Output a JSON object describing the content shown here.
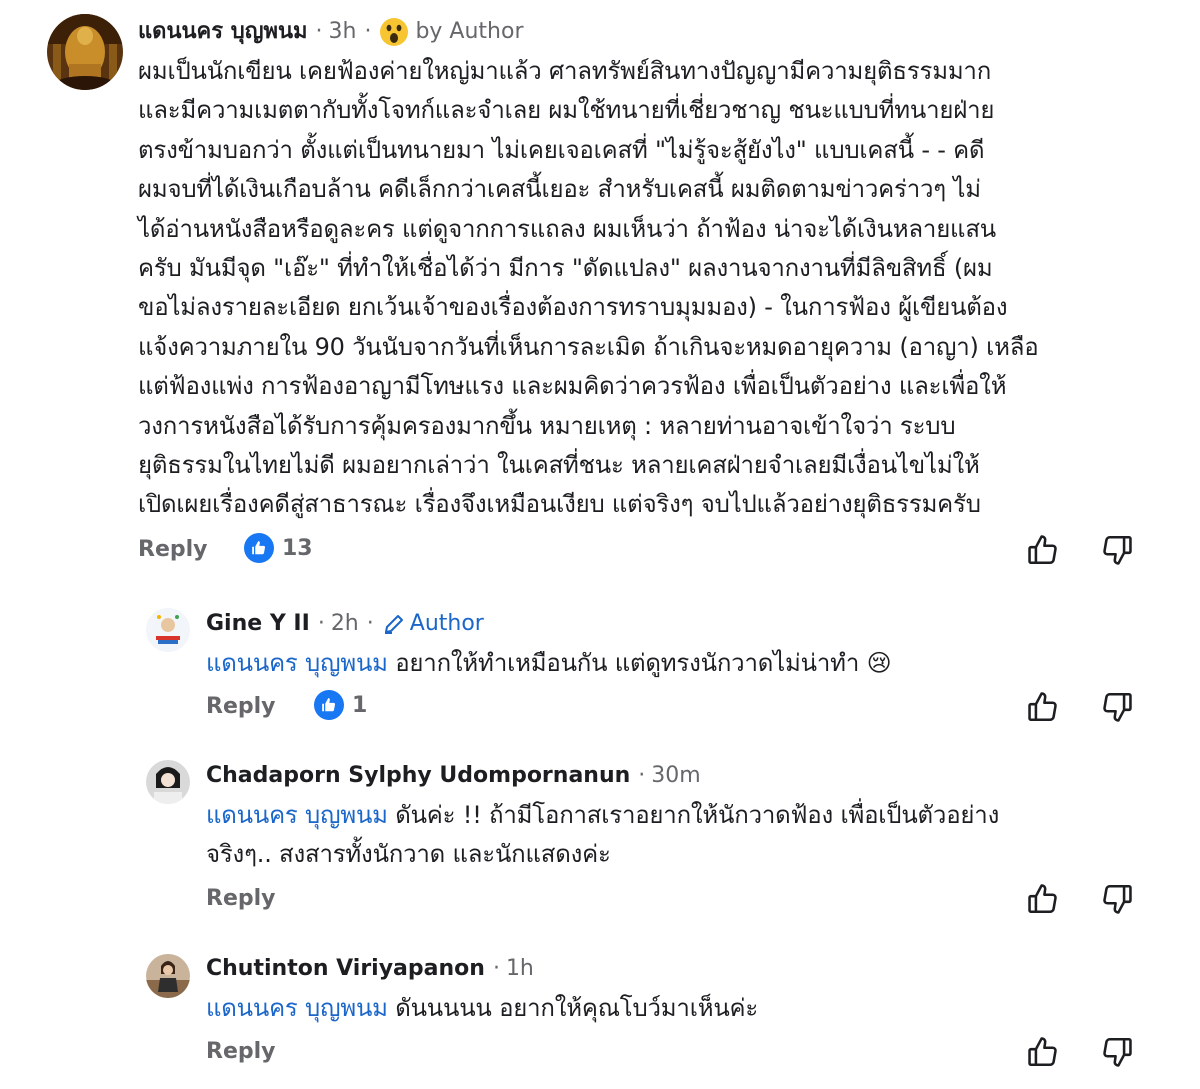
{
  "comments": [
    {
      "name": "แดนนคร บุญพนม",
      "time": "3h",
      "author_tag": "by Author",
      "mention": "",
      "lines": [
        "ผมเป็นนักเขียน  เคยฟ้องค่ายใหญ่มาแล้ว  ศาลทรัพย์สินทางปัญญามีความยุติธรรมมาก",
        "และมีความเมตตากับทั้งโจทก์และจำเลย  ผมใช้ทนายที่เชี่ยวชาญ  ชนะแบบที่ทนายฝ่าย",
        "ตรงข้ามบอกว่า ตั้งแต่เป็นทนายมา ไม่เคยเจอเคสที่ \"ไม่รู้จะสู้ยังไง\" แบบเคสนี้  - - คดี",
        "ผมจบที่ได้เงินเกือบล้าน  คดีเล็กกว่าเคสนี้เยอะ  สำหรับเคสนี้  ผมติดตามข่าวคร่าวๆ  ไม่",
        "ได้อ่านหนังสือหรือดูละคร  แต่ดูจากการแถลง  ผมเห็นว่า ถ้าฟ้อง น่าจะได้เงินหลายแสน",
        "ครับ  มันมีจุด \"เอ๊ะ\" ที่ทำให้เชื่อได้ว่า มีการ \"ดัดแปลง\" ผลงานจากงานที่มีลิขสิทธิ์  (ผม",
        "ขอไม่ลงรายละเอียด  ยกเว้นเจ้าของเรื่องต้องการทราบมุมมอง)  - ในการฟ้อง ผู้เขียนต้อง",
        "แจ้งความภายใน 90 วันนับจากวันที่เห็นการละเมิด ถ้าเกินจะหมดอายุความ (อาญา)  เหลือ",
        "แต่ฟ้องแพ่ง  การฟ้องอาญามีโทษแรง  และผมคิดว่าควรฟ้อง เพื่อเป็นตัวอย่าง และเพื่อให้",
        "วงการหนังสือได้รับการคุ้มครองมากขึ้น  หมายเหตุ : หลายท่านอาจเข้าใจว่า  ระบบ",
        "ยุติธรรมในไทยไม่ดี  ผมอยากเล่าว่า  ในเคสที่ชนะ  หลายเคสฝ่ายจำเลยมีเงื่อนไขไม่ให้",
        "เปิดเผยเรื่องคดีสู่สาธารณะ  เรื่องจึงเหมือนเงียบ  แต่จริงๆ  จบไปแล้วอย่างยุติธรรมครับ"
      ],
      "reply": "Reply",
      "likes": "13"
    },
    {
      "name": "Gine Y II",
      "time": "2h",
      "author_tag": "Author",
      "mention": "แดนนคร บุญพนม",
      "lines": [
        "อยากให้ทำเหมือนกัน แต่ดูทรงนักวาดไม่น่าทำ"
      ],
      "emoji": "😢",
      "reply": "Reply",
      "likes": "1"
    },
    {
      "name": "Chadaporn Sylphy Udompornanun",
      "time": "30m",
      "author_tag": "",
      "mention": "แดนนคร บุญพนม",
      "lines": [
        "ดันค่ะ !! ถ้ามีโอกาสเราอยากให้นักวาดฟ้อง เพื่อเป็นตัวอย่าง",
        "จริงๆ.. สงสารทั้งนักวาด และนักแสดงค่ะ"
      ],
      "reply": "Reply",
      "likes": ""
    },
    {
      "name": "Chutinton Viriyapanon",
      "time": "1h",
      "author_tag": "",
      "mention": "แดนนคร บุญพนม",
      "lines": [
        "ดันนนนน อยากให้คุณโบว์มาเห็นค่ะ"
      ],
      "reply": "Reply",
      "likes": ""
    }
  ],
  "separator": "·",
  "icons": {
    "like": "thumbs-up-icon",
    "dislike": "thumbs-down-icon",
    "reaction": "wow-emoji-icon",
    "edit": "pencil-icon"
  },
  "colors": {
    "mention": "#1b66c9",
    "like_badge": "#1877f2",
    "meta": "#65676b"
  }
}
